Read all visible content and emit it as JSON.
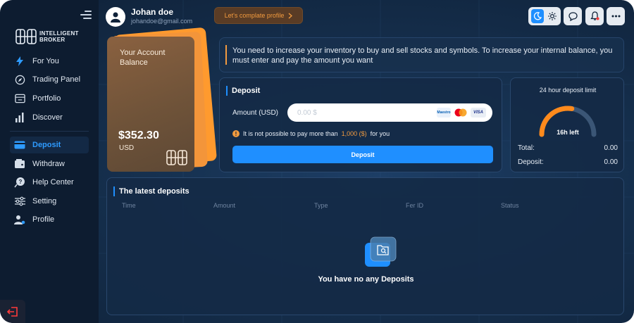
{
  "brand": {
    "name_line1": "INTELLIGENT",
    "name_line2": "BROKER"
  },
  "sidebar": {
    "items": [
      {
        "label": "For You",
        "icon": "bolt-icon"
      },
      {
        "label": "Trading Panel",
        "icon": "compass-icon"
      },
      {
        "label": "Portfolio",
        "icon": "portfolio-icon"
      },
      {
        "label": "Discover",
        "icon": "bar-chart-icon"
      },
      {
        "label": "Deposit",
        "icon": "card-icon",
        "active": true
      },
      {
        "label": "Withdraw",
        "icon": "wallet-icon"
      },
      {
        "label": "Help Center",
        "icon": "help-icon"
      },
      {
        "label": "Setting",
        "icon": "sliders-icon"
      },
      {
        "label": "Profile",
        "icon": "user-gear-icon"
      }
    ]
  },
  "header": {
    "user_name": "Johan doe",
    "user_email": "johandoe@gmail.com",
    "complete_profile_label": "Let's complate profile",
    "theme": "dark"
  },
  "balance_card": {
    "label": "Your Account Balance",
    "amount": "$352.30",
    "currency": "USD"
  },
  "notice": {
    "text": "You need to increase your inventory to buy and sell stocks and symbols. To increase your internal balance, you must enter and pay the amount you want"
  },
  "deposit": {
    "title": "Deposit",
    "amount_label": "Amount (USD)",
    "amount_placeholder": "0.00 $",
    "warning_prefix": "It is not possible to pay more than",
    "warning_limit": "1,000 ($)",
    "warning_suffix": "for you",
    "button_label": "Deposit",
    "payment_methods": [
      "Maestro",
      "Mastercard",
      "VISA"
    ]
  },
  "limit": {
    "title": "24 hour deposit limit",
    "remaining": "16h left",
    "remaining_fraction": 0.55,
    "total_label": "Total:",
    "total_value": "0.00",
    "deposit_label": "Deposit:",
    "deposit_value": "0.00"
  },
  "latest": {
    "title": "The latest deposits",
    "columns": [
      "Time",
      "Amount",
      "Type",
      "Fer ID",
      "Status"
    ],
    "empty_text": "You have no any Deposits"
  },
  "colors": {
    "accent": "#1f8fff",
    "orange": "#f29b3f",
    "background": "#163150"
  }
}
